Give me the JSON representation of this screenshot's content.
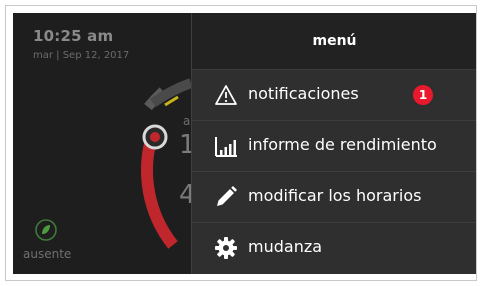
{
  "status": {
    "time": "10:25 am",
    "date": "mar | Sep 12, 2017",
    "mode_label": "ausente"
  },
  "menu": {
    "title": "menú",
    "items": [
      {
        "label": "notificaciones",
        "icon": "warning-icon",
        "badge": "1"
      },
      {
        "label": "informe de rendimiento",
        "icon": "bar-chart-icon"
      },
      {
        "label": "modificar los horarios",
        "icon": "pencil-icon"
      },
      {
        "label": "mudanza",
        "icon": "gear-icon"
      }
    ]
  },
  "colors": {
    "badge": "#e8192c",
    "dial_red": "#c0272d",
    "dial_yellow": "#c9b21c",
    "menu_bg": "#2f2f2f",
    "header_bg": "#222222"
  }
}
